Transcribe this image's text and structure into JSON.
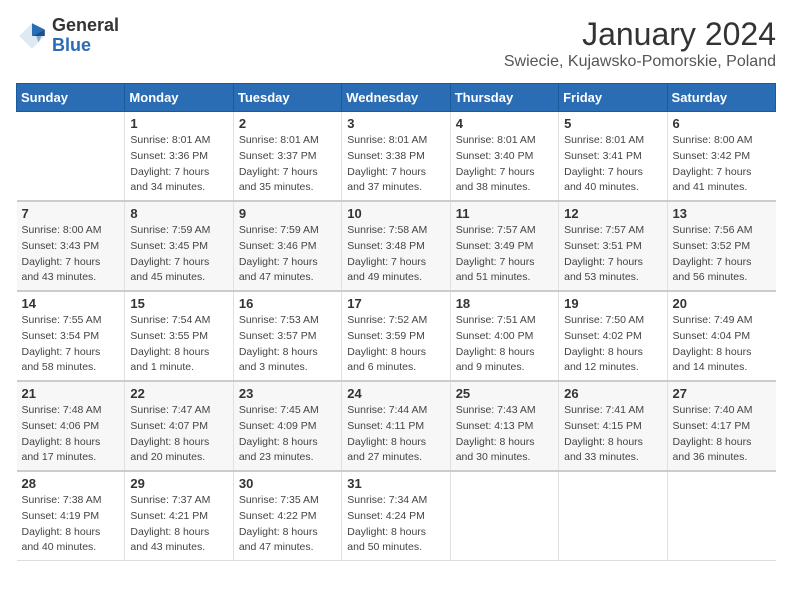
{
  "header": {
    "logo_general": "General",
    "logo_blue": "Blue",
    "month_title": "January 2024",
    "location": "Swiecie, Kujawsko-Pomorskie, Poland"
  },
  "days_of_week": [
    "Sunday",
    "Monday",
    "Tuesday",
    "Wednesday",
    "Thursday",
    "Friday",
    "Saturday"
  ],
  "weeks": [
    [
      {
        "day": "",
        "info": ""
      },
      {
        "day": "1",
        "info": "Sunrise: 8:01 AM\nSunset: 3:36 PM\nDaylight: 7 hours\nand 34 minutes."
      },
      {
        "day": "2",
        "info": "Sunrise: 8:01 AM\nSunset: 3:37 PM\nDaylight: 7 hours\nand 35 minutes."
      },
      {
        "day": "3",
        "info": "Sunrise: 8:01 AM\nSunset: 3:38 PM\nDaylight: 7 hours\nand 37 minutes."
      },
      {
        "day": "4",
        "info": "Sunrise: 8:01 AM\nSunset: 3:40 PM\nDaylight: 7 hours\nand 38 minutes."
      },
      {
        "day": "5",
        "info": "Sunrise: 8:01 AM\nSunset: 3:41 PM\nDaylight: 7 hours\nand 40 minutes."
      },
      {
        "day": "6",
        "info": "Sunrise: 8:00 AM\nSunset: 3:42 PM\nDaylight: 7 hours\nand 41 minutes."
      }
    ],
    [
      {
        "day": "7",
        "info": "Sunrise: 8:00 AM\nSunset: 3:43 PM\nDaylight: 7 hours\nand 43 minutes."
      },
      {
        "day": "8",
        "info": "Sunrise: 7:59 AM\nSunset: 3:45 PM\nDaylight: 7 hours\nand 45 minutes."
      },
      {
        "day": "9",
        "info": "Sunrise: 7:59 AM\nSunset: 3:46 PM\nDaylight: 7 hours\nand 47 minutes."
      },
      {
        "day": "10",
        "info": "Sunrise: 7:58 AM\nSunset: 3:48 PM\nDaylight: 7 hours\nand 49 minutes."
      },
      {
        "day": "11",
        "info": "Sunrise: 7:57 AM\nSunset: 3:49 PM\nDaylight: 7 hours\nand 51 minutes."
      },
      {
        "day": "12",
        "info": "Sunrise: 7:57 AM\nSunset: 3:51 PM\nDaylight: 7 hours\nand 53 minutes."
      },
      {
        "day": "13",
        "info": "Sunrise: 7:56 AM\nSunset: 3:52 PM\nDaylight: 7 hours\nand 56 minutes."
      }
    ],
    [
      {
        "day": "14",
        "info": "Sunrise: 7:55 AM\nSunset: 3:54 PM\nDaylight: 7 hours\nand 58 minutes."
      },
      {
        "day": "15",
        "info": "Sunrise: 7:54 AM\nSunset: 3:55 PM\nDaylight: 8 hours\nand 1 minute."
      },
      {
        "day": "16",
        "info": "Sunrise: 7:53 AM\nSunset: 3:57 PM\nDaylight: 8 hours\nand 3 minutes."
      },
      {
        "day": "17",
        "info": "Sunrise: 7:52 AM\nSunset: 3:59 PM\nDaylight: 8 hours\nand 6 minutes."
      },
      {
        "day": "18",
        "info": "Sunrise: 7:51 AM\nSunset: 4:00 PM\nDaylight: 8 hours\nand 9 minutes."
      },
      {
        "day": "19",
        "info": "Sunrise: 7:50 AM\nSunset: 4:02 PM\nDaylight: 8 hours\nand 12 minutes."
      },
      {
        "day": "20",
        "info": "Sunrise: 7:49 AM\nSunset: 4:04 PM\nDaylight: 8 hours\nand 14 minutes."
      }
    ],
    [
      {
        "day": "21",
        "info": "Sunrise: 7:48 AM\nSunset: 4:06 PM\nDaylight: 8 hours\nand 17 minutes."
      },
      {
        "day": "22",
        "info": "Sunrise: 7:47 AM\nSunset: 4:07 PM\nDaylight: 8 hours\nand 20 minutes."
      },
      {
        "day": "23",
        "info": "Sunrise: 7:45 AM\nSunset: 4:09 PM\nDaylight: 8 hours\nand 23 minutes."
      },
      {
        "day": "24",
        "info": "Sunrise: 7:44 AM\nSunset: 4:11 PM\nDaylight: 8 hours\nand 27 minutes."
      },
      {
        "day": "25",
        "info": "Sunrise: 7:43 AM\nSunset: 4:13 PM\nDaylight: 8 hours\nand 30 minutes."
      },
      {
        "day": "26",
        "info": "Sunrise: 7:41 AM\nSunset: 4:15 PM\nDaylight: 8 hours\nand 33 minutes."
      },
      {
        "day": "27",
        "info": "Sunrise: 7:40 AM\nSunset: 4:17 PM\nDaylight: 8 hours\nand 36 minutes."
      }
    ],
    [
      {
        "day": "28",
        "info": "Sunrise: 7:38 AM\nSunset: 4:19 PM\nDaylight: 8 hours\nand 40 minutes."
      },
      {
        "day": "29",
        "info": "Sunrise: 7:37 AM\nSunset: 4:21 PM\nDaylight: 8 hours\nand 43 minutes."
      },
      {
        "day": "30",
        "info": "Sunrise: 7:35 AM\nSunset: 4:22 PM\nDaylight: 8 hours\nand 47 minutes."
      },
      {
        "day": "31",
        "info": "Sunrise: 7:34 AM\nSunset: 4:24 PM\nDaylight: 8 hours\nand 50 minutes."
      },
      {
        "day": "",
        "info": ""
      },
      {
        "day": "",
        "info": ""
      },
      {
        "day": "",
        "info": ""
      }
    ]
  ]
}
